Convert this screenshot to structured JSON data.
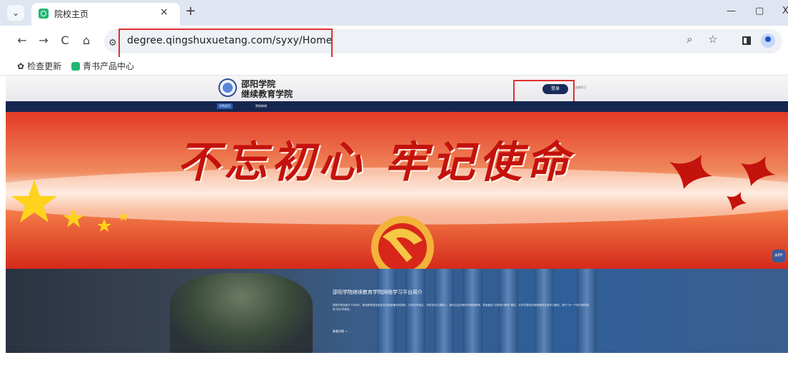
{
  "browser": {
    "tab": {
      "title": "院校主页",
      "close": "×"
    },
    "new_tab": "+",
    "controls": {
      "minimize": "—",
      "restore": "▢",
      "close": "X"
    },
    "nav": {
      "back": "←",
      "forward": "→",
      "reload": "C",
      "home": "⌂"
    },
    "address": {
      "url": "degree.qingshuxuetang.com/syxy/Home"
    },
    "toolbar_icons": {
      "zoom": "zoom-icon",
      "bookmark": "star-icon",
      "side_panel": "side-panel-icon",
      "profile": "avatar"
    }
  },
  "bookmarks": [
    {
      "label": "检查更新",
      "icon": "gear-icon"
    },
    {
      "label": "青书产品中心",
      "icon": "favicon"
    }
  ],
  "site": {
    "logo_line1": "邵阳学院",
    "logo_line2": "继续教育学院",
    "login_label": "登录",
    "register_label": "注册学习",
    "nav": [
      {
        "label": "学院首页",
        "active": true
      },
      {
        "label": "院校新闻",
        "active": false
      }
    ]
  },
  "banner": {
    "slogan": "不忘初心 牢记使命"
  },
  "intro": {
    "title": "邵阳学院继续教育学院网络学习平台简介",
    "body": "邵阳学院创建于1958年，是经教育部批准的全日制普通本科院校，办学历史悠久。学校坚持立德树人，面向社会开展学历继续教育，探索建设“互联网+教育”模式，为学员提供优质便捷的在线学习服务，践行“为一个地方服务到底”的办学理念。",
    "more_label": "查看详情 →"
  },
  "colors": {
    "highlight_box": "#e03030",
    "site_nav": "#15264f",
    "login_button": "#1a2c5c",
    "banner_red": "#e33a25"
  }
}
